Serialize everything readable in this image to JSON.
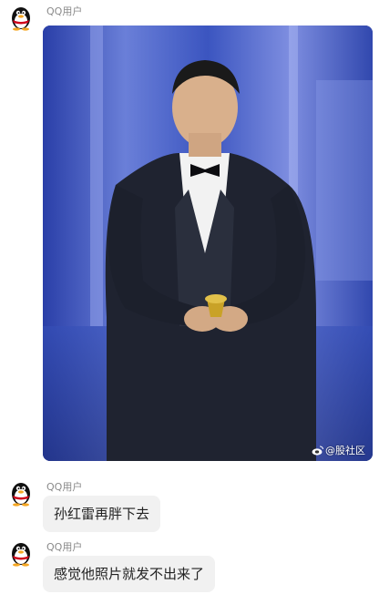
{
  "messages": [
    {
      "sender": "QQ用户",
      "type": "image",
      "image_alt": "",
      "watermark": "@股社区"
    },
    {
      "sender": "QQ用户",
      "type": "text",
      "text": "孙红雷再胖下去"
    },
    {
      "sender": "QQ用户",
      "type": "text",
      "text": "感觉他照片就发不出来了"
    }
  ],
  "colors": {
    "bubble_bg": "#f1f1f1",
    "sender_text": "#8a8a8a",
    "message_text": "#222222",
    "photo_bg": "#2b3c8a"
  },
  "icons": {
    "avatar": "qq-penguin-icon",
    "watermark": "weibo-icon"
  }
}
